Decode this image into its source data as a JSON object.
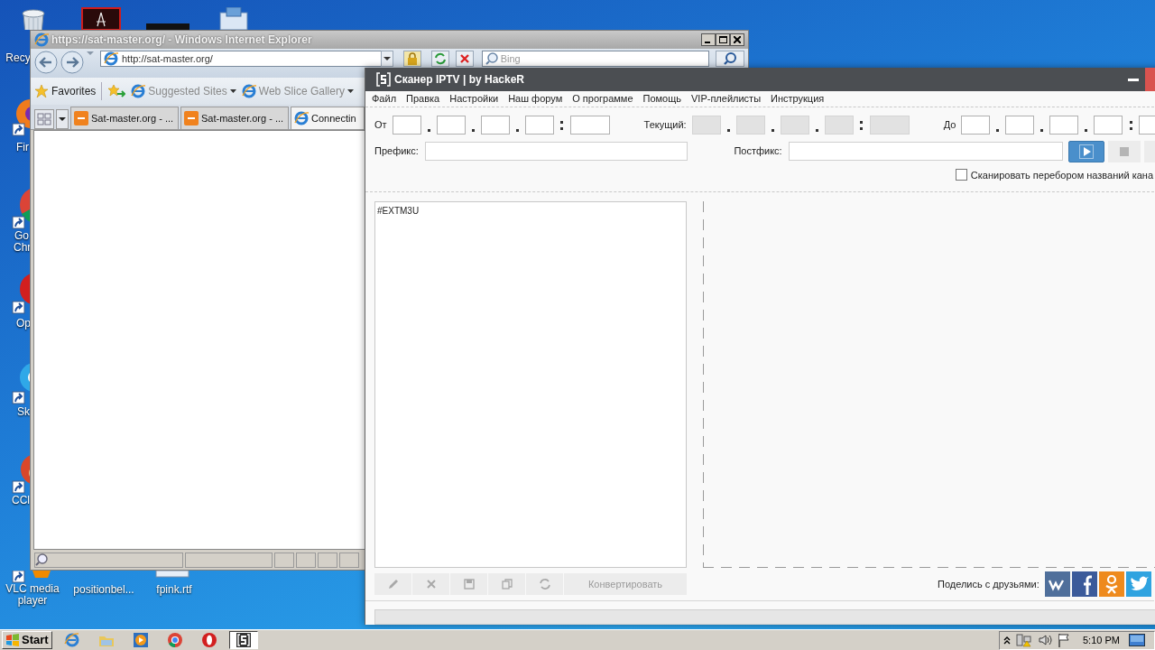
{
  "desktop": {
    "icons": [
      {
        "kind": "recycle",
        "label": "Recy"
      },
      {
        "kind": "pdf"
      },
      {
        "kind": "dark"
      },
      {
        "kind": "installer"
      },
      {
        "kind": "firefox",
        "label": "Fir"
      },
      {
        "kind": "chrome",
        "label": "Go Chr"
      },
      {
        "kind": "opera",
        "label": "Op"
      },
      {
        "kind": "skype",
        "label": "Sk"
      },
      {
        "kind": "ccleaner",
        "label": "CCl"
      },
      {
        "kind": "vlc",
        "label": "VLC media player"
      },
      {
        "label": "positionbel..."
      },
      {
        "kind": "rtf",
        "label": "fpink.rtf"
      }
    ]
  },
  "browser": {
    "title": "https://sat-master.org/ - Windows Internet Explorer",
    "address": "http://sat-master.org/",
    "search_placeholder": "Bing",
    "favorites_label": "Favorites",
    "favorites": [
      {
        "label": "Suggested Sites"
      },
      {
        "label": "Web Slice Gallery"
      }
    ],
    "tabs": [
      {
        "label": "Sat-master.org - ...",
        "selected": false,
        "kind": "site"
      },
      {
        "label": "Sat-master.org - ...",
        "selected": false,
        "kind": "site"
      },
      {
        "label": "Connectin",
        "selected": true,
        "kind": "loading"
      }
    ]
  },
  "app": {
    "title": "Сканер IPTV | by HackeR",
    "menu": [
      "Файл",
      "Правка",
      "Настройки",
      "Наш форум",
      "О программе",
      "Помощь",
      "VIP-плейлисты",
      "Инструкция"
    ],
    "ip_ranges": [
      {
        "label": "От",
        "disabled": false
      },
      {
        "label": "Текущий:",
        "disabled": true
      },
      {
        "label": "До",
        "disabled": false
      }
    ],
    "prefix": {
      "label": "Префикс:"
    },
    "postfix": {
      "label": "Постфикс:"
    },
    "scan_by_names": {
      "label": "Сканировать перебором названий кана",
      "checked": false
    },
    "playlist": "#EXTM3U",
    "toolbar": {
      "disabled": true,
      "convert_label": "Конвертировать"
    },
    "share_label": "Поделись с друзьями:"
  },
  "taskbar": {
    "start_label": "Start",
    "apps": [
      {
        "kind": "ie",
        "selected": false
      },
      {
        "kind": "folder",
        "selected": false
      },
      {
        "kind": "media",
        "selected": false
      },
      {
        "kind": "chrome",
        "selected": false
      },
      {
        "kind": "opera",
        "selected": false
      },
      {
        "kind": "scanner",
        "selected": true
      }
    ],
    "clock": "5:10 PM"
  }
}
